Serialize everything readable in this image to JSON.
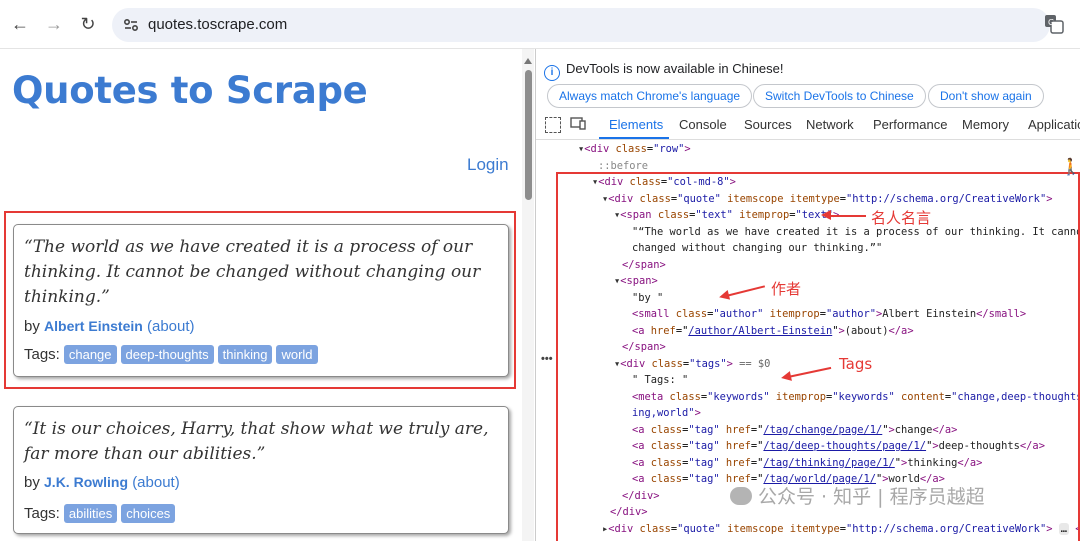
{
  "browser": {
    "url": "quotes.toscrape.com",
    "back_icon": "←",
    "forward_icon": "→",
    "reload_icon": "↻"
  },
  "page": {
    "title": "Quotes to Scrape",
    "login": "Login",
    "quotes": [
      {
        "text": "“The world as we have created it is a process of our thinking. It cannot be changed without changing our thinking.”",
        "by": "by",
        "author": "Albert Einstein",
        "about": "(about)",
        "tags_label": "Tags:",
        "tags": [
          "change",
          "deep-thoughts",
          "thinking",
          "world"
        ]
      },
      {
        "text": "“It is our choices, Harry, that show what we truly are, far more than our abilities.”",
        "by": "by",
        "author": "J.K. Rowling",
        "about": "(about)",
        "tags_label": "Tags:",
        "tags": [
          "abilities",
          "choices"
        ]
      }
    ]
  },
  "devtools": {
    "notice": "DevTools is now available in Chinese!",
    "buttons": [
      "Always match Chrome's language",
      "Switch DevTools to Chinese",
      "Don't show again"
    ],
    "tabs": [
      "Elements",
      "Console",
      "Sources",
      "Network",
      "Performance",
      "Memory",
      "Applicatio"
    ],
    "active_tab": "Elements",
    "lines": {
      "l1_tag": "<div ",
      "l1_an": "class",
      "l1_av": "\"row\"",
      "l1_end": ">",
      "l2": "::before",
      "l3_tag": "<div ",
      "l3_an": "class",
      "l3_av": "\"col-md-8\"",
      "l3_end": ">",
      "l4_tag": "<div ",
      "l4_an1": "class",
      "l4_av1": "\"quote\"",
      "l4_an2": " itemscope itemtype",
      "l4_av2": "\"http://schema.org/CreativeWork\"",
      "l4_end": ">",
      "l5_tag": "<span ",
      "l5_an1": "class",
      "l5_av1": "\"text\"",
      "l5_an2": " itemprop",
      "l5_av2": "\"text\"",
      "l5_end": ">",
      "l6": "\"“The world as we have created it is a process of our thinking. It cannot be",
      "l7": "changed without changing our thinking.”\"",
      "l8": "</span>",
      "l9": "<span>",
      "l10": "\"by \"",
      "l11_tag": "<small ",
      "l11_an1": "class",
      "l11_av1": "\"author\"",
      "l11_an2": " itemprop",
      "l11_av2": "\"author\"",
      "l11_text": "Albert Einstein",
      "l11_close": "</small>",
      "l12_tag": "<a ",
      "l12_an": "href",
      "l12_av": "/author/Albert-Einstein",
      "l12_text": "(about)",
      "l12_close": "</a>",
      "l13": "</span>",
      "l14_tag": "<div ",
      "l14_an": "class",
      "l14_av": "\"tags\"",
      "l14_end": ">",
      "l14_eq": " == $0",
      "l15": "\" Tags: \"",
      "l16_tag": "<meta ",
      "l16_an1": "class",
      "l16_av1": "\"keywords\"",
      "l16_an2": " itemprop",
      "l16_av2": "\"keywords\"",
      "l16_an3": " content",
      "l16_av3": "\"change,deep-thoughts,thinki",
      "l17": "ing,world\"",
      "l17_end": ">",
      "tag_links": [
        {
          "href": "/tag/change/page/1/",
          "text": "change"
        },
        {
          "href": "/tag/deep-thoughts/page/1/",
          "text": "deep-thoughts"
        },
        {
          "href": "/tag/thinking/page/1/",
          "text": "thinking"
        },
        {
          "href": "/tag/world/page/1/",
          "text": "world"
        }
      ],
      "tag_an": "class",
      "tag_av": "\"tag\"",
      "tag_href_an": " href",
      "l22": "</div>",
      "l23": "</div>",
      "l24_tag": "<div ",
      "l24_an1": "class",
      "l24_av1": "\"quote\"",
      "l24_an2": " itemscope itemtype",
      "l24_av2": "\"http://schema.org/CreativeWork\"",
      "l24_end": "> ",
      "l24_more": "…",
      "l24_close": " </div>"
    }
  },
  "annotations": {
    "quote": "名人名言",
    "author": "作者",
    "tags": "Tags"
  },
  "watermark": "公众号 · 知乎 | 程序员越超"
}
